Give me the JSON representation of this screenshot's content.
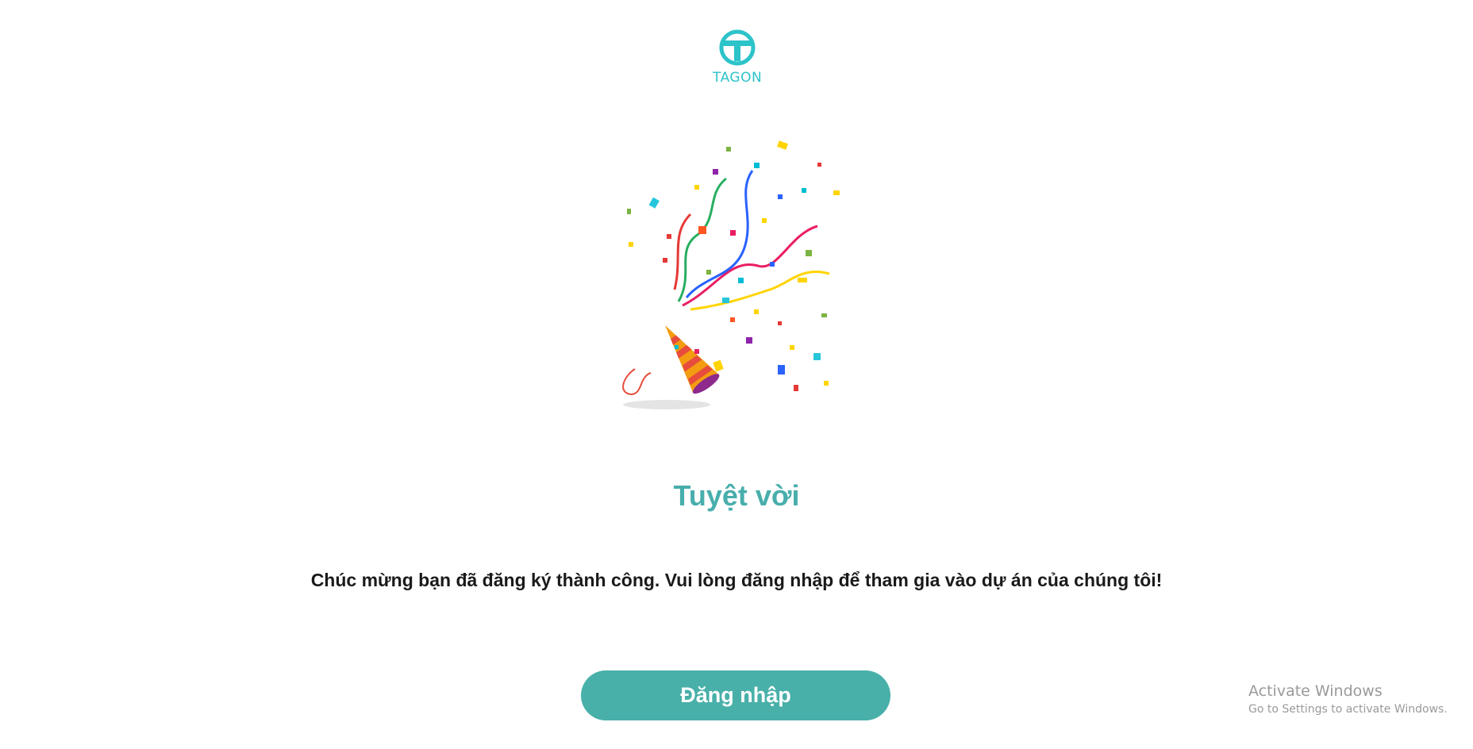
{
  "logo": {
    "text": "TAGON",
    "color": "#2cc3c9"
  },
  "illustration": {
    "icon": "party-popper-icon"
  },
  "content": {
    "title": "Tuyệt vời",
    "message": "Chúc mừng bạn đã đăng ký thành công. Vui lòng đăng nhập để tham gia vào dự án của chúng tôi!",
    "title_color": "#48aeac"
  },
  "actions": {
    "login_label": "Đăng nhập",
    "button_color": "#48b0a9"
  },
  "watermark": {
    "title": "Activate Windows",
    "subtitle": "Go to Settings to activate Windows."
  }
}
